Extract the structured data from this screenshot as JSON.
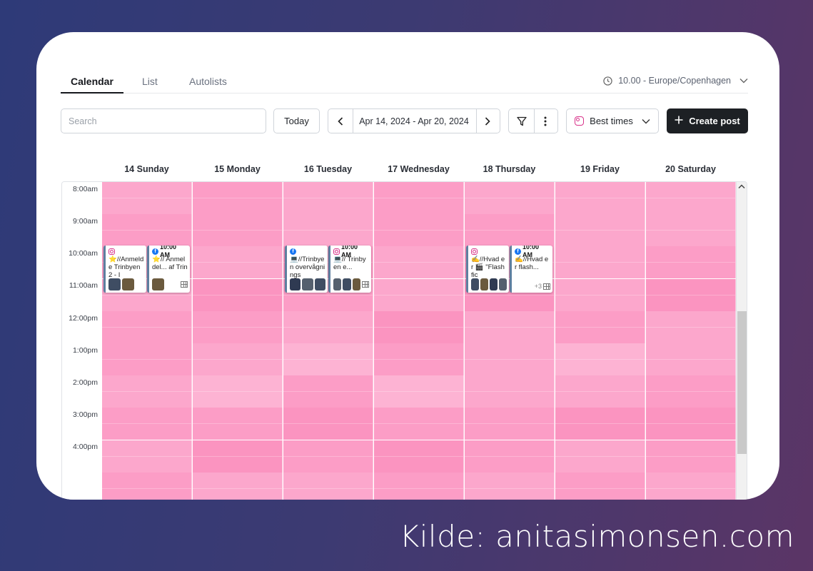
{
  "tabs": [
    {
      "label": "Calendar",
      "active": true
    },
    {
      "label": "List",
      "active": false
    },
    {
      "label": "Autolists",
      "active": false
    }
  ],
  "timezone": "10.00 - Europe/Copenhagen",
  "toolbar": {
    "search_placeholder": "Search",
    "today_label": "Today",
    "date_range": "Apr 14, 2024 - Apr 20, 2024",
    "best_times_label": "Best times",
    "create_label": "Create post"
  },
  "days": [
    "14 Sunday",
    "15 Monday",
    "16 Tuesday",
    "17 Wednesday",
    "18 Thursday",
    "19 Friday",
    "20 Saturday"
  ],
  "hours": [
    "8:00am",
    "9:00am",
    "10:00am",
    "11:00am",
    "12:00pm",
    "1:00pm",
    "2:00pm",
    "3:00pm",
    "4:00pm"
  ],
  "heat_colors": [
    "#fca7cc",
    "#fc9dc6",
    "#fb94c0",
    "#fdb3d3"
  ],
  "posts": [
    {
      "day": 0,
      "network": "instagram",
      "time": "",
      "text": "⭐//Anmelde Trinbyen 2 - I",
      "thumbs": 2,
      "more": ""
    },
    {
      "day": 0,
      "network": "facebook",
      "time": "10:00 AM",
      "text": "⭐// Anmeldel... af Trin",
      "thumbs": 1,
      "more": ""
    },
    {
      "day": 2,
      "network": "facebook",
      "time": "",
      "text": "💻//Trinbyen overvågnings",
      "thumbs": 3,
      "more": ""
    },
    {
      "day": 2,
      "network": "instagram",
      "time": "10:00 AM",
      "text": "💻// Trinbyen e...",
      "thumbs": 3,
      "more": ""
    },
    {
      "day": 4,
      "network": "instagram",
      "time": "",
      "text": "✍️//Hvad er 🎬 \"Flash fic",
      "thumbs": 4,
      "more": ""
    },
    {
      "day": 4,
      "network": "facebook",
      "time": "10:00 AM",
      "text": "✍️//Hvad er flash...",
      "thumbs": 0,
      "more": "+3"
    }
  ],
  "source": "Kilde: anitasimonsen.com"
}
